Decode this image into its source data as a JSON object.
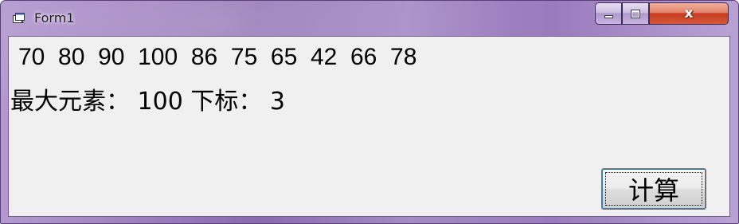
{
  "window": {
    "title": "Form1",
    "icon": "form-app-icon",
    "accent_frame_color": "#9e7fbf",
    "close_button_color": "#c63a1e"
  },
  "caption_buttons": {
    "minimize": "minimize-icon",
    "maximize": "maximize-icon",
    "close_glyph": "x"
  },
  "content": {
    "array_text": "70  80  90  100  86  75  65  42  66  78",
    "result_text": "最大元素： 100 下标： 3"
  },
  "buttons": {
    "calculate_label": "计算"
  }
}
